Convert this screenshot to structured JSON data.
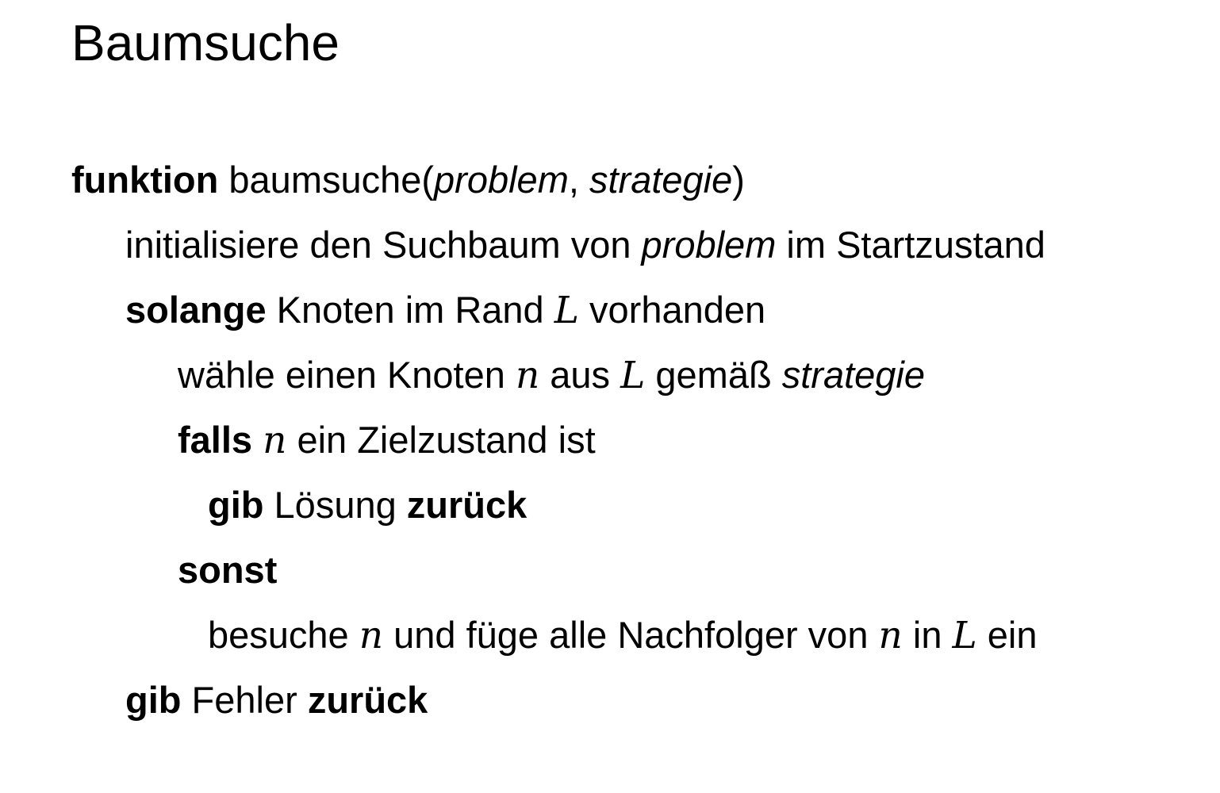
{
  "title": "Baumsuche",
  "lines": [
    {
      "keyword": "funktion",
      "name": "baumsuche(",
      "param1": "problem",
      "sep": ", ",
      "param2": "strategie",
      "close": ")"
    },
    {
      "pre": "initialisiere den Suchbaum von ",
      "var": "problem",
      "post": " im Startzustand"
    },
    {
      "keyword": "solange",
      "text": " Knoten im Rand ",
      "var": "L",
      "post": " vorhanden"
    },
    {
      "pre": "wähle einen Knoten ",
      "var1": "n",
      "mid": " aus ",
      "var2": "L",
      "post": " gemäß ",
      "param": "strategie"
    },
    {
      "keyword": "falls",
      "sp": " ",
      "var": "n",
      "post": " ein Zielzustand ist"
    },
    {
      "keyword1": "gib",
      "text": " Lösung ",
      "keyword2": "zurück"
    },
    {
      "keyword": "sonst"
    },
    {
      "pre": "besuche ",
      "var1": "n",
      "mid1": " und füge alle Nachfolger von ",
      "var2": "n",
      "mid2": " in ",
      "var3": "L",
      "post": " ein"
    },
    {
      "keyword1": "gib",
      "text": " Fehler ",
      "keyword2": "zurück"
    }
  ]
}
